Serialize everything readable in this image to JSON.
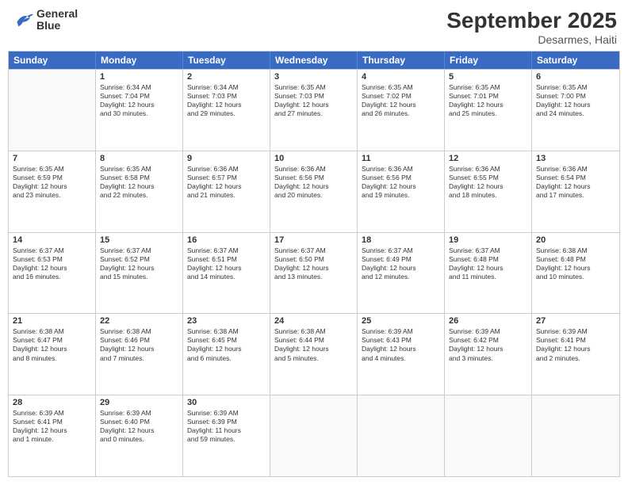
{
  "header": {
    "logo": {
      "line1": "General",
      "line2": "Blue"
    },
    "title": "September 2025",
    "subtitle": "Desarmes, Haiti"
  },
  "days_of_week": [
    "Sunday",
    "Monday",
    "Tuesday",
    "Wednesday",
    "Thursday",
    "Friday",
    "Saturday"
  ],
  "weeks": [
    [
      {
        "day": "",
        "info": ""
      },
      {
        "day": "1",
        "info": "Sunrise: 6:34 AM\nSunset: 7:04 PM\nDaylight: 12 hours\nand 30 minutes."
      },
      {
        "day": "2",
        "info": "Sunrise: 6:34 AM\nSunset: 7:03 PM\nDaylight: 12 hours\nand 29 minutes."
      },
      {
        "day": "3",
        "info": "Sunrise: 6:35 AM\nSunset: 7:03 PM\nDaylight: 12 hours\nand 27 minutes."
      },
      {
        "day": "4",
        "info": "Sunrise: 6:35 AM\nSunset: 7:02 PM\nDaylight: 12 hours\nand 26 minutes."
      },
      {
        "day": "5",
        "info": "Sunrise: 6:35 AM\nSunset: 7:01 PM\nDaylight: 12 hours\nand 25 minutes."
      },
      {
        "day": "6",
        "info": "Sunrise: 6:35 AM\nSunset: 7:00 PM\nDaylight: 12 hours\nand 24 minutes."
      }
    ],
    [
      {
        "day": "7",
        "info": "Sunrise: 6:35 AM\nSunset: 6:59 PM\nDaylight: 12 hours\nand 23 minutes."
      },
      {
        "day": "8",
        "info": "Sunrise: 6:35 AM\nSunset: 6:58 PM\nDaylight: 12 hours\nand 22 minutes."
      },
      {
        "day": "9",
        "info": "Sunrise: 6:36 AM\nSunset: 6:57 PM\nDaylight: 12 hours\nand 21 minutes."
      },
      {
        "day": "10",
        "info": "Sunrise: 6:36 AM\nSunset: 6:56 PM\nDaylight: 12 hours\nand 20 minutes."
      },
      {
        "day": "11",
        "info": "Sunrise: 6:36 AM\nSunset: 6:56 PM\nDaylight: 12 hours\nand 19 minutes."
      },
      {
        "day": "12",
        "info": "Sunrise: 6:36 AM\nSunset: 6:55 PM\nDaylight: 12 hours\nand 18 minutes."
      },
      {
        "day": "13",
        "info": "Sunrise: 6:36 AM\nSunset: 6:54 PM\nDaylight: 12 hours\nand 17 minutes."
      }
    ],
    [
      {
        "day": "14",
        "info": "Sunrise: 6:37 AM\nSunset: 6:53 PM\nDaylight: 12 hours\nand 16 minutes."
      },
      {
        "day": "15",
        "info": "Sunrise: 6:37 AM\nSunset: 6:52 PM\nDaylight: 12 hours\nand 15 minutes."
      },
      {
        "day": "16",
        "info": "Sunrise: 6:37 AM\nSunset: 6:51 PM\nDaylight: 12 hours\nand 14 minutes."
      },
      {
        "day": "17",
        "info": "Sunrise: 6:37 AM\nSunset: 6:50 PM\nDaylight: 12 hours\nand 13 minutes."
      },
      {
        "day": "18",
        "info": "Sunrise: 6:37 AM\nSunset: 6:49 PM\nDaylight: 12 hours\nand 12 minutes."
      },
      {
        "day": "19",
        "info": "Sunrise: 6:37 AM\nSunset: 6:48 PM\nDaylight: 12 hours\nand 11 minutes."
      },
      {
        "day": "20",
        "info": "Sunrise: 6:38 AM\nSunset: 6:48 PM\nDaylight: 12 hours\nand 10 minutes."
      }
    ],
    [
      {
        "day": "21",
        "info": "Sunrise: 6:38 AM\nSunset: 6:47 PM\nDaylight: 12 hours\nand 8 minutes."
      },
      {
        "day": "22",
        "info": "Sunrise: 6:38 AM\nSunset: 6:46 PM\nDaylight: 12 hours\nand 7 minutes."
      },
      {
        "day": "23",
        "info": "Sunrise: 6:38 AM\nSunset: 6:45 PM\nDaylight: 12 hours\nand 6 minutes."
      },
      {
        "day": "24",
        "info": "Sunrise: 6:38 AM\nSunset: 6:44 PM\nDaylight: 12 hours\nand 5 minutes."
      },
      {
        "day": "25",
        "info": "Sunrise: 6:39 AM\nSunset: 6:43 PM\nDaylight: 12 hours\nand 4 minutes."
      },
      {
        "day": "26",
        "info": "Sunrise: 6:39 AM\nSunset: 6:42 PM\nDaylight: 12 hours\nand 3 minutes."
      },
      {
        "day": "27",
        "info": "Sunrise: 6:39 AM\nSunset: 6:41 PM\nDaylight: 12 hours\nand 2 minutes."
      }
    ],
    [
      {
        "day": "28",
        "info": "Sunrise: 6:39 AM\nSunset: 6:41 PM\nDaylight: 12 hours\nand 1 minute."
      },
      {
        "day": "29",
        "info": "Sunrise: 6:39 AM\nSunset: 6:40 PM\nDaylight: 12 hours\nand 0 minutes."
      },
      {
        "day": "30",
        "info": "Sunrise: 6:39 AM\nSunset: 6:39 PM\nDaylight: 11 hours\nand 59 minutes."
      },
      {
        "day": "",
        "info": ""
      },
      {
        "day": "",
        "info": ""
      },
      {
        "day": "",
        "info": ""
      },
      {
        "day": "",
        "info": ""
      }
    ]
  ]
}
